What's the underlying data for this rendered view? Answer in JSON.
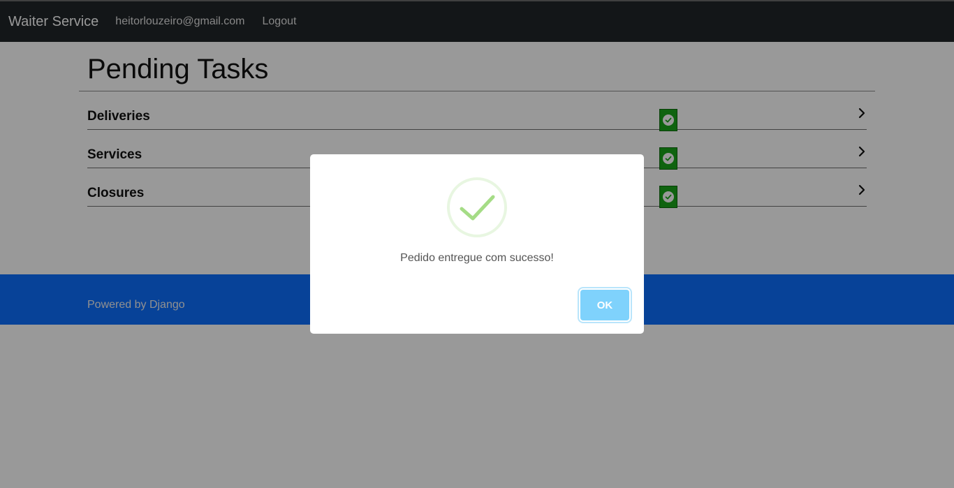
{
  "navbar": {
    "brand": "Waiter Service",
    "email": "heitorlouzeiro@gmail.com",
    "logout": "Logout",
    "background": "#212529"
  },
  "page": {
    "title": "Pending Tasks"
  },
  "tasks": [
    {
      "label": "Deliveries",
      "status": "check-circle-icon"
    },
    {
      "label": "Services",
      "status": "check-circle-icon"
    },
    {
      "label": "Closures",
      "status": "check-circle-icon"
    }
  ],
  "footer": {
    "text": "Powered by Django",
    "background": "#0d6efd"
  },
  "modal": {
    "icon": "success-check-icon",
    "message": "Pedido entregue com sucesso!",
    "ok_label": "OK",
    "ok_color": "#7fd2fc",
    "check_color": "#a5dc86"
  },
  "colors": {
    "status_green": "#1aa51a"
  }
}
